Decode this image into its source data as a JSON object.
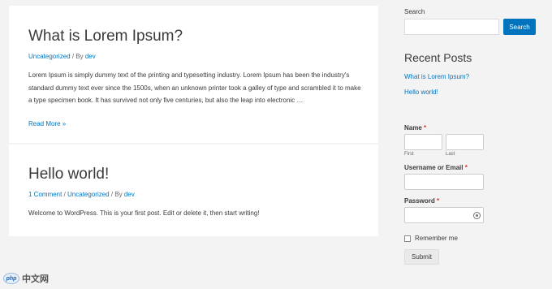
{
  "posts": [
    {
      "title": "What is Lorem Ipsum?",
      "meta": {
        "category": "Uncategorized",
        "sep": " / By ",
        "author": "dev"
      },
      "excerpt": "Lorem Ipsum is simply dummy text of the printing and typesetting industry. Lorem Ipsum has been the industry's standard dummy text ever since the 1500s, when an unknown printer took a galley of type and scrambled it to make a type specimen book. It has survived not only five centuries, but also the leap into electronic …",
      "read_more": "Read More »"
    },
    {
      "title": "Hello world!",
      "meta": {
        "comments": "1 Comment",
        "sep1": " / ",
        "category": "Uncategorized",
        "sep2": " / By ",
        "author": "dev"
      },
      "excerpt": "Welcome to WordPress. This is your first post. Edit or delete it, then start writing!"
    }
  ],
  "sidebar": {
    "search": {
      "label": "Search",
      "value": "",
      "button": "Search"
    },
    "recent_posts": {
      "title": "Recent Posts",
      "items": [
        "What is Lorem Ipsum?",
        "Hello world!"
      ]
    },
    "form": {
      "name_label": "Name",
      "required_mark": "*",
      "first_label": "First",
      "last_label": "Last",
      "username_label": "Username or Email",
      "password_label": "Password",
      "remember_label": "Remember me",
      "submit_label": "Submit"
    }
  },
  "watermark": {
    "logo": "php",
    "text": "中文网"
  },
  "colors": {
    "accent": "#0274be",
    "background": "#f3f3f3",
    "required": "#dc3232"
  }
}
